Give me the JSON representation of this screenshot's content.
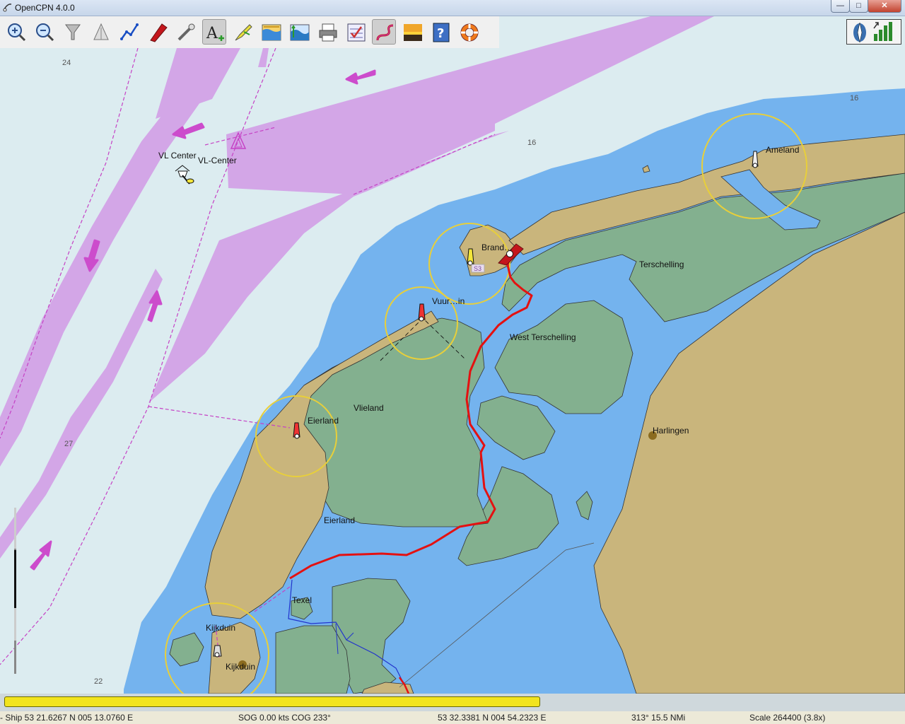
{
  "window": {
    "title": "OpenCPN 4.0.0",
    "min": "—",
    "max": "□",
    "close": "✕"
  },
  "toolbar": {
    "tools": [
      "zoom-in-icon",
      "zoom-out-icon",
      "filter-icon",
      "anchor-icon",
      "route-icon",
      "ship-icon",
      "measure-icon",
      "text-icon",
      "mark-icon",
      "tide-icon",
      "current-icon",
      "print-icon",
      "settings-icon",
      "track-icon",
      "day-night-icon",
      "help-icon",
      "lifebuoy-icon"
    ],
    "active": [
      "text-icon",
      "track-icon"
    ]
  },
  "colors": {
    "land": "#c9b57c",
    "drying": "#83b08f",
    "deep_water": "#dcecf0",
    "shallow_water": "#74b3ee",
    "traffic_lane": "#d3a6e7",
    "route": "#e41111",
    "light_sector": "#e8cf3a"
  },
  "map": {
    "places": [
      "VL Center",
      "VL-Center",
      "Ameland",
      "Brand…",
      "Terschelling",
      "Vuur…in",
      "West Terschelling",
      "Vlieland",
      "Eierland",
      "Eierland",
      "Harlingen",
      "Texel",
      "Kijkduin",
      "Kijkduin"
    ],
    "depths": [
      "24",
      "16",
      "16",
      "27",
      "22"
    ],
    "buoy_label": "S3"
  },
  "progress": {
    "fraction": 0.6
  },
  "status": {
    "ship": " - Ship 53 21.6267 N   005 13.0760 E",
    "sog_cog": "SOG 0.00 kts  COG 233°",
    "cursor": "53 32.3381 N   004 54.2323 E",
    "bearing": "313°  15.5 NMi",
    "scale": "Scale 264400 (3.8x)"
  }
}
